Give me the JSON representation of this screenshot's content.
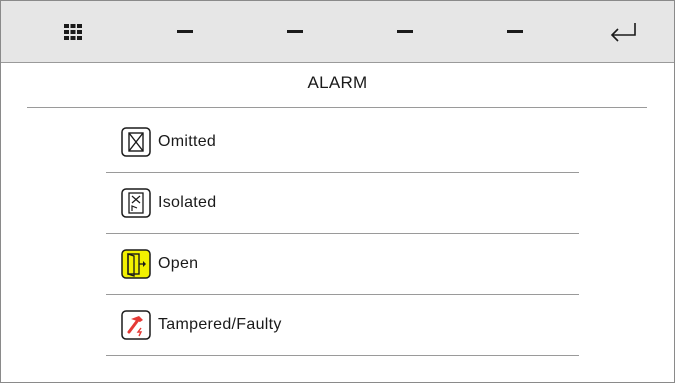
{
  "topbar": {
    "menu_icon": "grid-menu-icon",
    "slots": [
      "–",
      "–",
      "–",
      "–"
    ],
    "back_icon": "return-arrow-icon"
  },
  "page": {
    "title": "ALARM"
  },
  "states": [
    {
      "label": "Omitted",
      "icon": "omitted-icon",
      "color": "#ffffff"
    },
    {
      "label": "Isolated",
      "icon": "isolated-icon",
      "color": "#ffffff"
    },
    {
      "label": "Open",
      "icon": "door-open-icon",
      "color": "#f2f000"
    },
    {
      "label": "Tampered/Faulty",
      "icon": "tampered-hammer-icon",
      "color": "#e53935"
    }
  ]
}
